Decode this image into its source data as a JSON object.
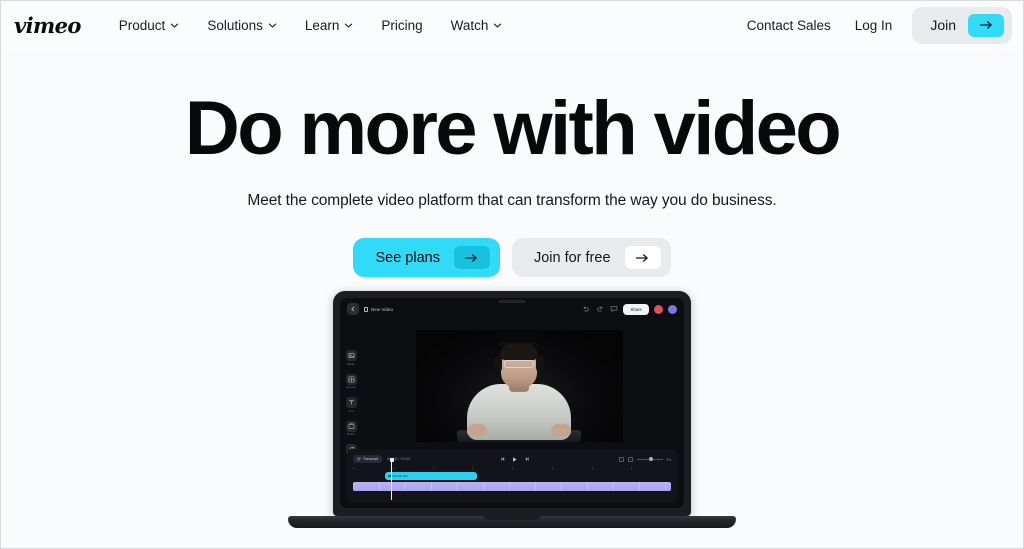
{
  "brand": {
    "logo_text": "vimeo",
    "accent_cyan": "#31dbf8",
    "chip_gray": "#e9eaee",
    "page_bg": "#fafbfd"
  },
  "nav": {
    "items": [
      {
        "label": "Product",
        "has_chevron": true
      },
      {
        "label": "Solutions",
        "has_chevron": true
      },
      {
        "label": "Learn",
        "has_chevron": true
      },
      {
        "label": "Pricing",
        "has_chevron": false
      },
      {
        "label": "Watch",
        "has_chevron": true
      }
    ],
    "contact_sales": "Contact Sales",
    "log_in": "Log In",
    "join": "Join"
  },
  "hero": {
    "headline": "Do more with video",
    "subhead": "Meet the complete video platform that can transform the way you do business.",
    "cta_primary": "See plans",
    "cta_secondary": "Join for free"
  },
  "editor": {
    "project_title": "New Video",
    "share_label": "Share",
    "sidebar": [
      {
        "label": "Media"
      },
      {
        "label": "Layouts"
      },
      {
        "label": "Text"
      },
      {
        "label": "Brand"
      },
      {
        "label": "Audio"
      }
    ],
    "timeline": {
      "transcript_label": "Transcript",
      "timecode": "00:06 / 03:00",
      "clip_label": "My first film",
      "zoom_label": "Fit"
    }
  }
}
